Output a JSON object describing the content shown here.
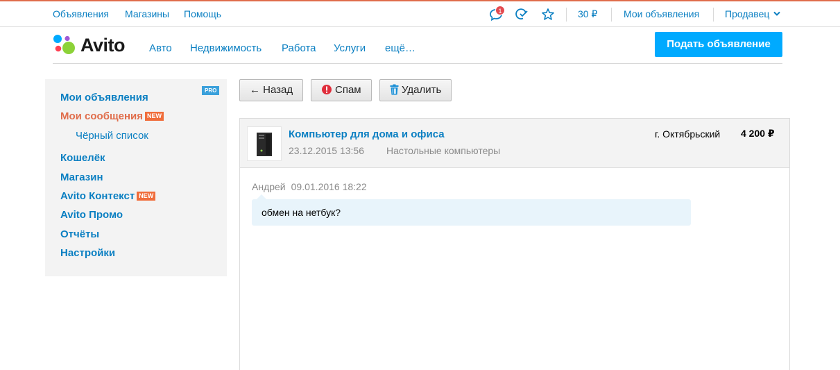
{
  "topbar": {
    "links": [
      "Объявления",
      "Магазины",
      "Помощь"
    ],
    "notification_count": "1",
    "balance": "30 ₽",
    "my_ads": "Мои объявления",
    "user_menu": "Продавец"
  },
  "header": {
    "logo": "Avito",
    "nav": [
      "Авто",
      "Недвижимость",
      "Работа",
      "Услуги",
      "ещё…"
    ],
    "cta": "Подать объявление"
  },
  "sidebar": {
    "items": [
      {
        "label": "Мои объявления",
        "tag": "PRO"
      },
      {
        "label": "Мои сообщения",
        "tag": "NEW",
        "active": true
      },
      {
        "label": "Чёрный список"
      },
      {
        "label": "Кошелёк"
      },
      {
        "label": "Магазин"
      },
      {
        "label": "Avito Контекст",
        "tag": "NEW"
      },
      {
        "label": "Avito Промо"
      },
      {
        "label": "Отчёты"
      },
      {
        "label": "Настройки"
      }
    ]
  },
  "actions": {
    "back": "← Назад",
    "spam": "Спам",
    "delete": "Удалить"
  },
  "item": {
    "title": "Компьютер для дома и офиса",
    "date": "23.12.2015 13:56",
    "category": "Настольные компьютеры",
    "city": "г. Октябрьский",
    "price": "4 200 ₽"
  },
  "message": {
    "author": "Андрей",
    "date": "09.01.2016 18:22",
    "text": "обмен на нетбук?"
  },
  "colors": {
    "link": "#0a7fc2",
    "accent": "#e06d4b",
    "cta": "#00aaff",
    "bubble": "#e8f4fb"
  }
}
